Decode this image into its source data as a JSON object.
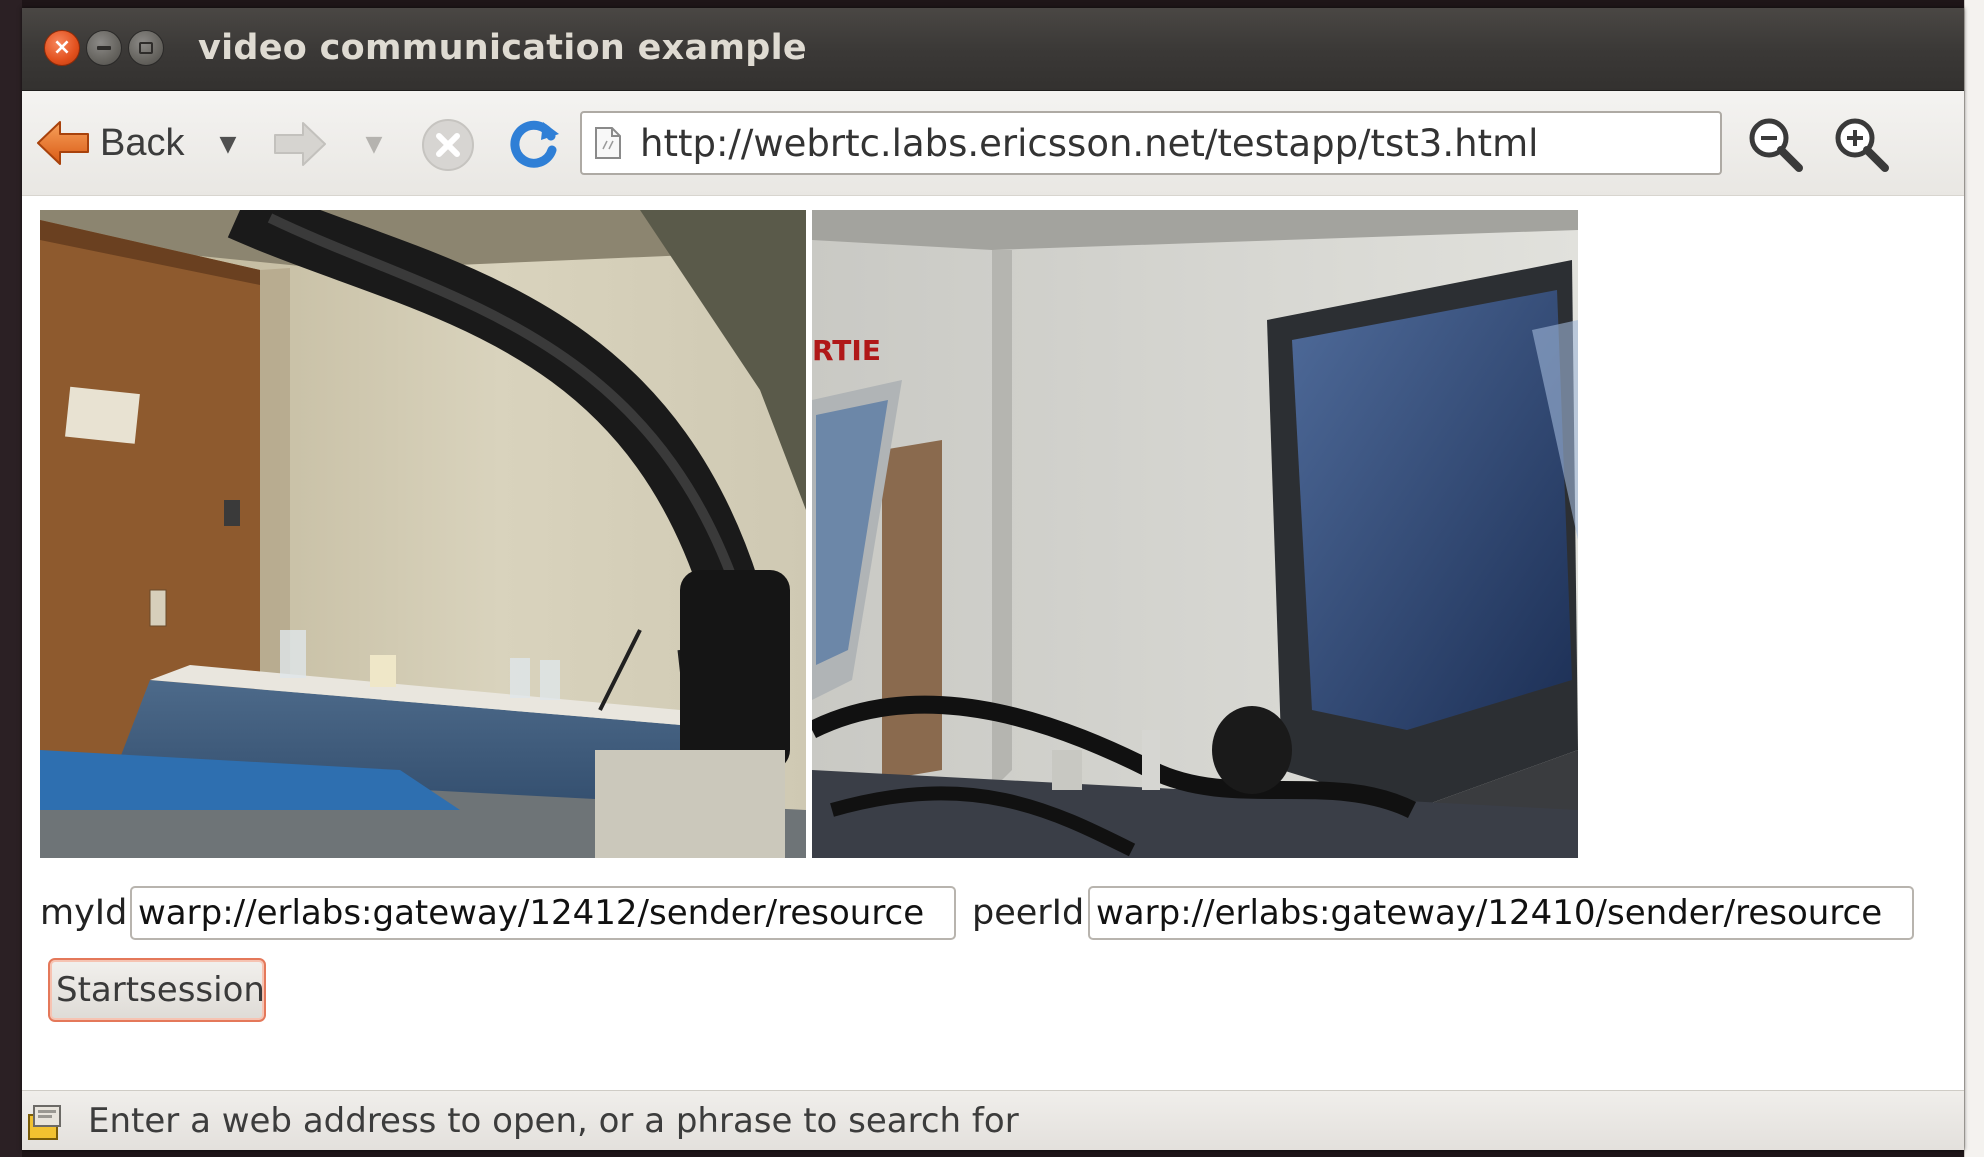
{
  "window": {
    "title": "video communication example"
  },
  "toolbar": {
    "back_label": "Back",
    "url": "http://webrtc.labs.ericsson.net/testapp/tst3.html"
  },
  "main": {
    "myid_label": "myId:",
    "myid_value": "warp://erlabs:gateway/12412/sender/resource",
    "peerid_label": "peerId:",
    "peerid_value": "warp://erlabs:gateway/12410/sender/resource",
    "start_button_label": "Startsession",
    "remote_video_sign": "RTIE"
  },
  "statusbar": {
    "text": "Enter a web address to open, or a phrase to search for"
  },
  "colors": {
    "titlebar": "#3b3937",
    "close_button": "#e2501d",
    "start_button_border": "#e4785a",
    "reload_icon": "#2f7fd6",
    "back_arrow": "#e8702a"
  },
  "icons": {
    "window_controls": [
      "close-icon",
      "minimize-icon",
      "maximize-icon"
    ],
    "toolbar": [
      "back-arrow-icon",
      "chevron-down-icon",
      "forward-arrow-icon",
      "stop-icon",
      "reload-icon",
      "page-icon",
      "zoom-out-icon",
      "zoom-in-icon"
    ],
    "status": "security-lock-icon"
  }
}
